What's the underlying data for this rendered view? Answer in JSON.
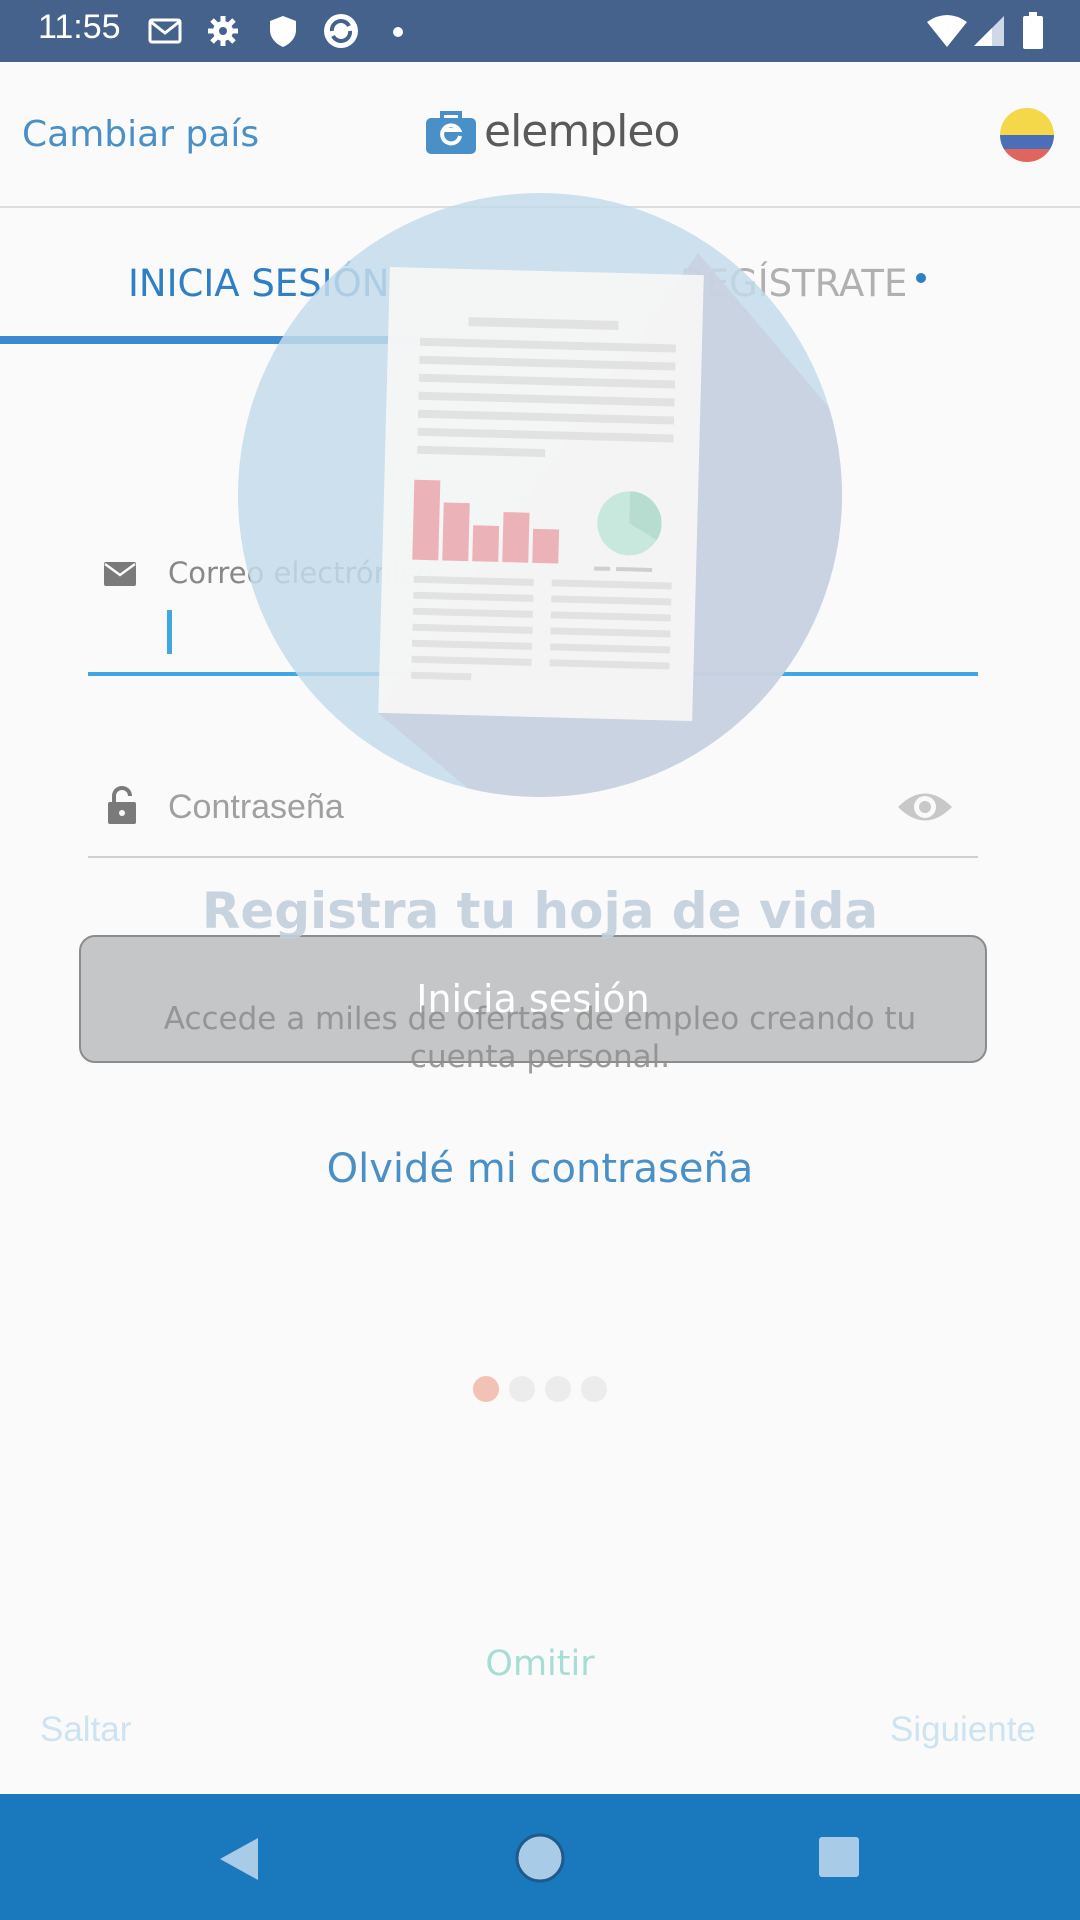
{
  "status_bar": {
    "time": "11:55",
    "icons": [
      "gmail-icon",
      "settings-icon",
      "shield-icon",
      "sync-icon",
      "dot-icon",
      "wifi-icon",
      "signal-icon",
      "battery-icon"
    ]
  },
  "header": {
    "change_country_label": "Cambiar país",
    "logo_text": "elempleo",
    "country_flag": "colombia-flag-icon"
  },
  "tabs": [
    {
      "label": "INICIA SESIÓN",
      "active": true
    },
    {
      "label": "REGÍSTRATE",
      "active": false
    }
  ],
  "login_form": {
    "email_label": "Correo electrónico",
    "email_value": "",
    "password_placeholder": "Contraseña",
    "login_button_label": "Inicia sesión",
    "forgot_password_label": "Olvidé mi contraseña"
  },
  "onboarding_overlay": {
    "title": "Registra tu hoja de vida",
    "subtitle": "Accede a miles de ofertas de empleo creando tu cuenta personal.",
    "page_count": 4,
    "current_page": 1,
    "omit_label": "Omitir",
    "skip_label": "Saltar",
    "next_label": "Siguiente"
  },
  "colors": {
    "status_bar": "#44628c",
    "brand_blue": "#2f7fc6",
    "nav_bar": "#1a78bc",
    "active_dot": "#f3c2b6",
    "inactive_dot": "#ececec"
  }
}
